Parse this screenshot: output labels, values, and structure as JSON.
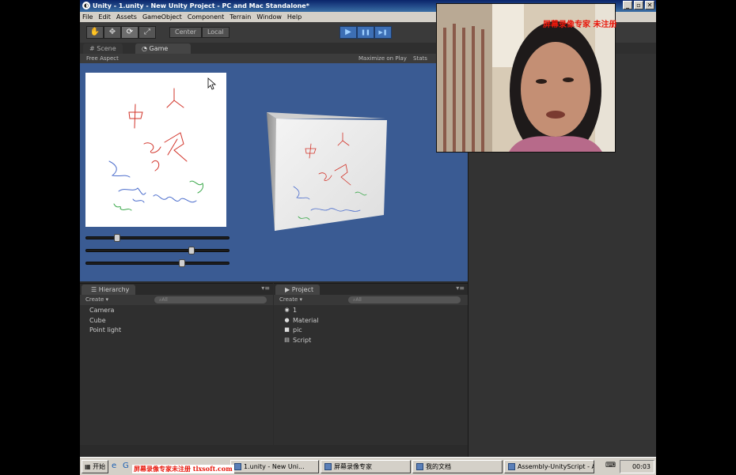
{
  "window": {
    "title": "Unity - 1.unity - New Unity Project - PC and Mac Standalone*",
    "min": "_",
    "max": "▫",
    "close": "✕"
  },
  "menu": [
    "File",
    "Edit",
    "Assets",
    "GameObject",
    "Component",
    "Terrain",
    "Window",
    "Help"
  ],
  "toolbar": {
    "tools": [
      {
        "icon": "hand-icon",
        "glyph": "✋"
      },
      {
        "icon": "move-icon",
        "glyph": "✥"
      },
      {
        "icon": "rotate-icon",
        "glyph": "⟳"
      },
      {
        "icon": "scale-icon",
        "glyph": "⤢"
      }
    ],
    "pivot": "Center",
    "space": "Local",
    "play": "▶",
    "pause": "❚❚",
    "step": "▶❚"
  },
  "tabs": {
    "scene": "Scene",
    "game": "Game"
  },
  "gamebar": {
    "aspect": "Free Aspect",
    "maximize": "Maximize on Play",
    "stats": "Stats"
  },
  "sliders": [
    0.2,
    0.74,
    0.67
  ],
  "hierarchy": {
    "title": "Hierarchy",
    "create": "Create",
    "search": "All",
    "items": [
      "Camera",
      "Cube",
      "Point light"
    ]
  },
  "project": {
    "title": "Project",
    "create": "Create",
    "search": "All",
    "items": [
      {
        "icon": "scene-icon",
        "glyph": "◉",
        "label": "1"
      },
      {
        "icon": "material-icon",
        "glyph": "●",
        "label": "Material"
      },
      {
        "icon": "texture-icon",
        "glyph": "■",
        "label": "pic"
      },
      {
        "icon": "script-icon",
        "glyph": "▤",
        "label": "Script"
      }
    ]
  },
  "watermark": "屏幕录像专家 未注册",
  "taskbar": {
    "start": "开始",
    "watermark": "屏幕录像专家未注册 tlxsoft.com",
    "buttons": [
      "1.unity - New Uni...",
      "屏幕录像专家",
      "我的文档",
      "Assembly-UnityScript - A..."
    ],
    "clock": "00:03"
  },
  "colors": {
    "game_bg": "#3a5b93",
    "stroke_red": "#d2342a",
    "stroke_blue": "#4a6ccc",
    "stroke_green": "#3aa84a"
  }
}
